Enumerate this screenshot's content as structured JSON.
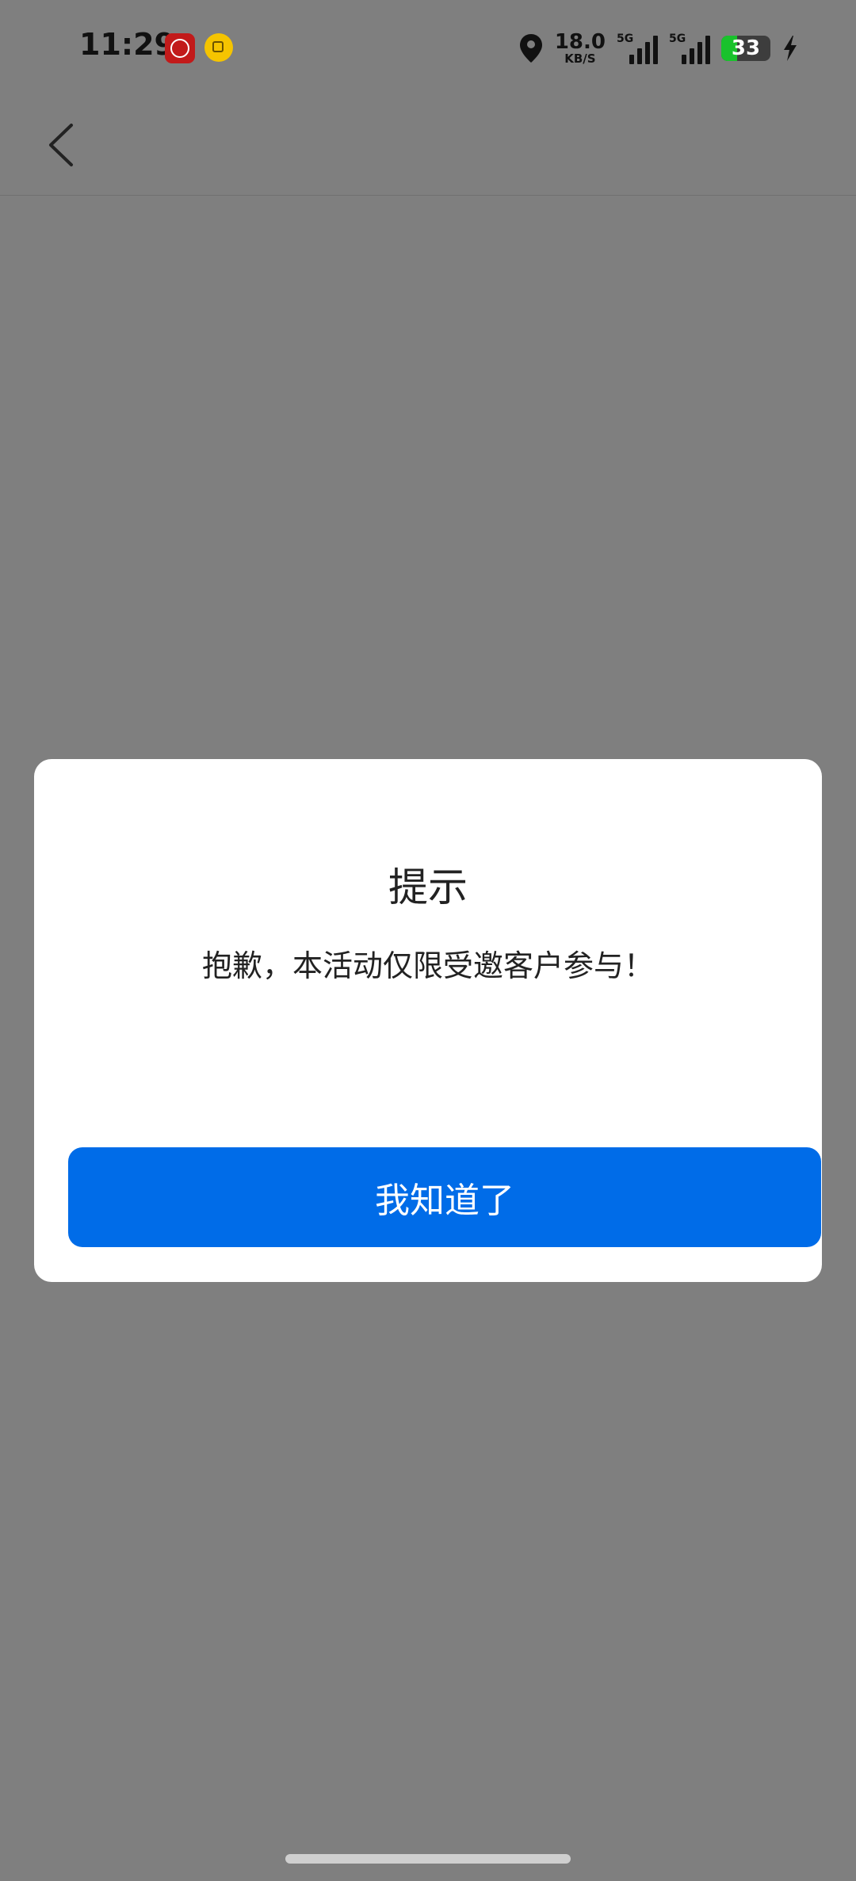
{
  "status_bar": {
    "time": "11:29",
    "net_speed_value": "18.0",
    "net_speed_unit": "KB/S",
    "signal_1_label": "5G",
    "signal_2_label": "5G",
    "battery_level": "33",
    "battery_fill_percent": 33,
    "battery_color": "#19c22c",
    "icons": [
      "bank-app-icon",
      "copy-app-icon",
      "location-icon",
      "signal-icon",
      "battery-icon",
      "charging-icon"
    ]
  },
  "nav_bar": {
    "back_icon": "chevron-left-icon"
  },
  "dialog": {
    "title": "提示",
    "message": "抱歉，本活动仅限受邀客户参与！",
    "confirm_label": "我知道了",
    "confirm_color": "#006ce8"
  }
}
